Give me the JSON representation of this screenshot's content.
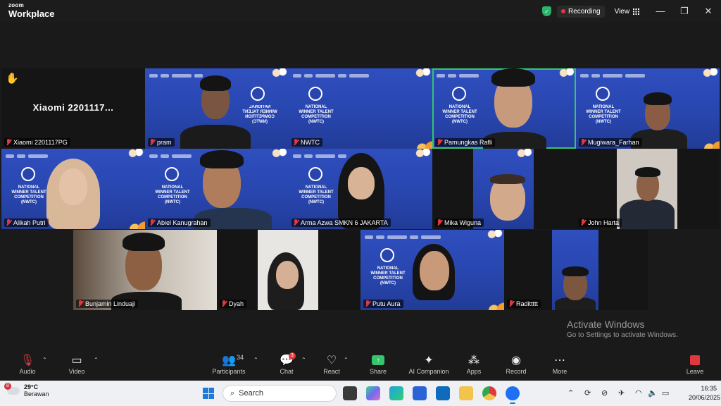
{
  "titlebar": {
    "brand_top": "zoom",
    "brand_bottom": "Workplace",
    "recording_label": "Recording",
    "view_label": "View",
    "minimize": "—",
    "restore": "❐",
    "close": "✕"
  },
  "participants": [
    {
      "name": "Xiaomi 2201117PG",
      "display_text": "Xiaomi  2201117..."
    },
    {
      "name": "pram"
    },
    {
      "name": "NWTC"
    },
    {
      "name": "Pamungkas Rafli"
    },
    {
      "name": "Mugiwara_Farhan"
    },
    {
      "name": "Alikah Putri"
    },
    {
      "name": "Abiel Kanugrahan"
    },
    {
      "name": "Arma Azwa SMKN 6 JAKARTA"
    },
    {
      "name": "Mika Wiguna"
    },
    {
      "name": "John Harta"
    },
    {
      "name": "Bunjamin Linduaji"
    },
    {
      "name": "Dyah"
    },
    {
      "name": "Putu Aura"
    },
    {
      "name": "Radittttt"
    }
  ],
  "event_banner": {
    "line1": "NATIONAL",
    "line2": "WINNER TALENT",
    "line3": "COMPETITION",
    "line4": "(NWTC)"
  },
  "watermark": {
    "title": "Activate Windows",
    "subtitle": "Go to Settings to activate Windows."
  },
  "toolbar": {
    "audio": "Audio",
    "video": "Video",
    "participants": "Participants",
    "participants_count": "34",
    "chat": "Chat",
    "chat_badge": "3",
    "react": "React",
    "share": "Share",
    "ai_companion": "AI Companion",
    "apps": "Apps",
    "record": "Record",
    "more": "More",
    "leave": "Leave"
  },
  "taskbar": {
    "weather_badge": "8",
    "temperature": "29°C",
    "condition": "Berawan",
    "search_placeholder": "Search",
    "time": "16:35",
    "date": "20/06/2025"
  },
  "colors": {
    "active_speaker": "#35c56d",
    "event_blue": "#2845ad",
    "mute_red": "#e0383e"
  }
}
